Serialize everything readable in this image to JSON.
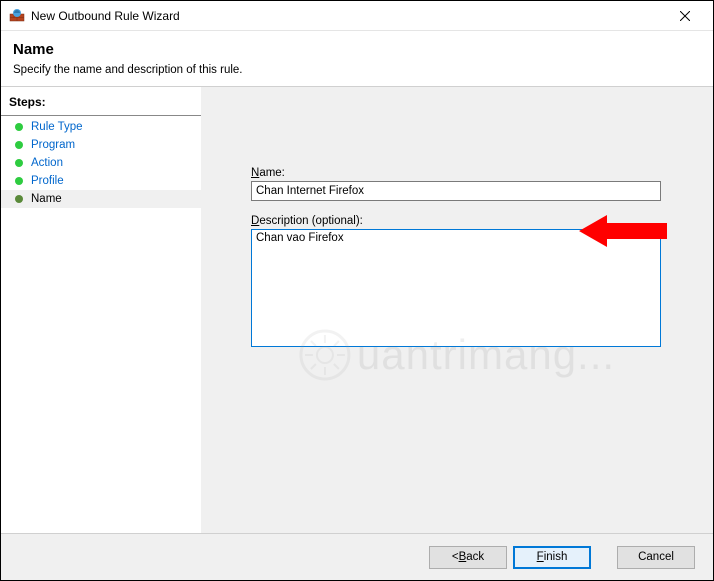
{
  "window": {
    "title": "New Outbound Rule Wizard"
  },
  "header": {
    "title": "Name",
    "subtitle": "Specify the name and description of this rule."
  },
  "sidebar": {
    "label": "Steps:",
    "items": [
      {
        "label": "Rule Type",
        "active": false
      },
      {
        "label": "Program",
        "active": false
      },
      {
        "label": "Action",
        "active": false
      },
      {
        "label": "Profile",
        "active": false
      },
      {
        "label": "Name",
        "active": true
      }
    ]
  },
  "form": {
    "name_prefix": "N",
    "name_suffix": "ame:",
    "name_value": "Chan Internet Firefox",
    "desc_prefix": "D",
    "desc_suffix": "escription (optional):",
    "desc_value": "Chan vao Firefox"
  },
  "buttons": {
    "back_prefix": "< ",
    "back_u": "B",
    "back_suffix": "ack",
    "finish_u": "F",
    "finish_suffix": "inish",
    "cancel": "Cancel"
  },
  "watermark": {
    "text": "uantrimang..."
  }
}
